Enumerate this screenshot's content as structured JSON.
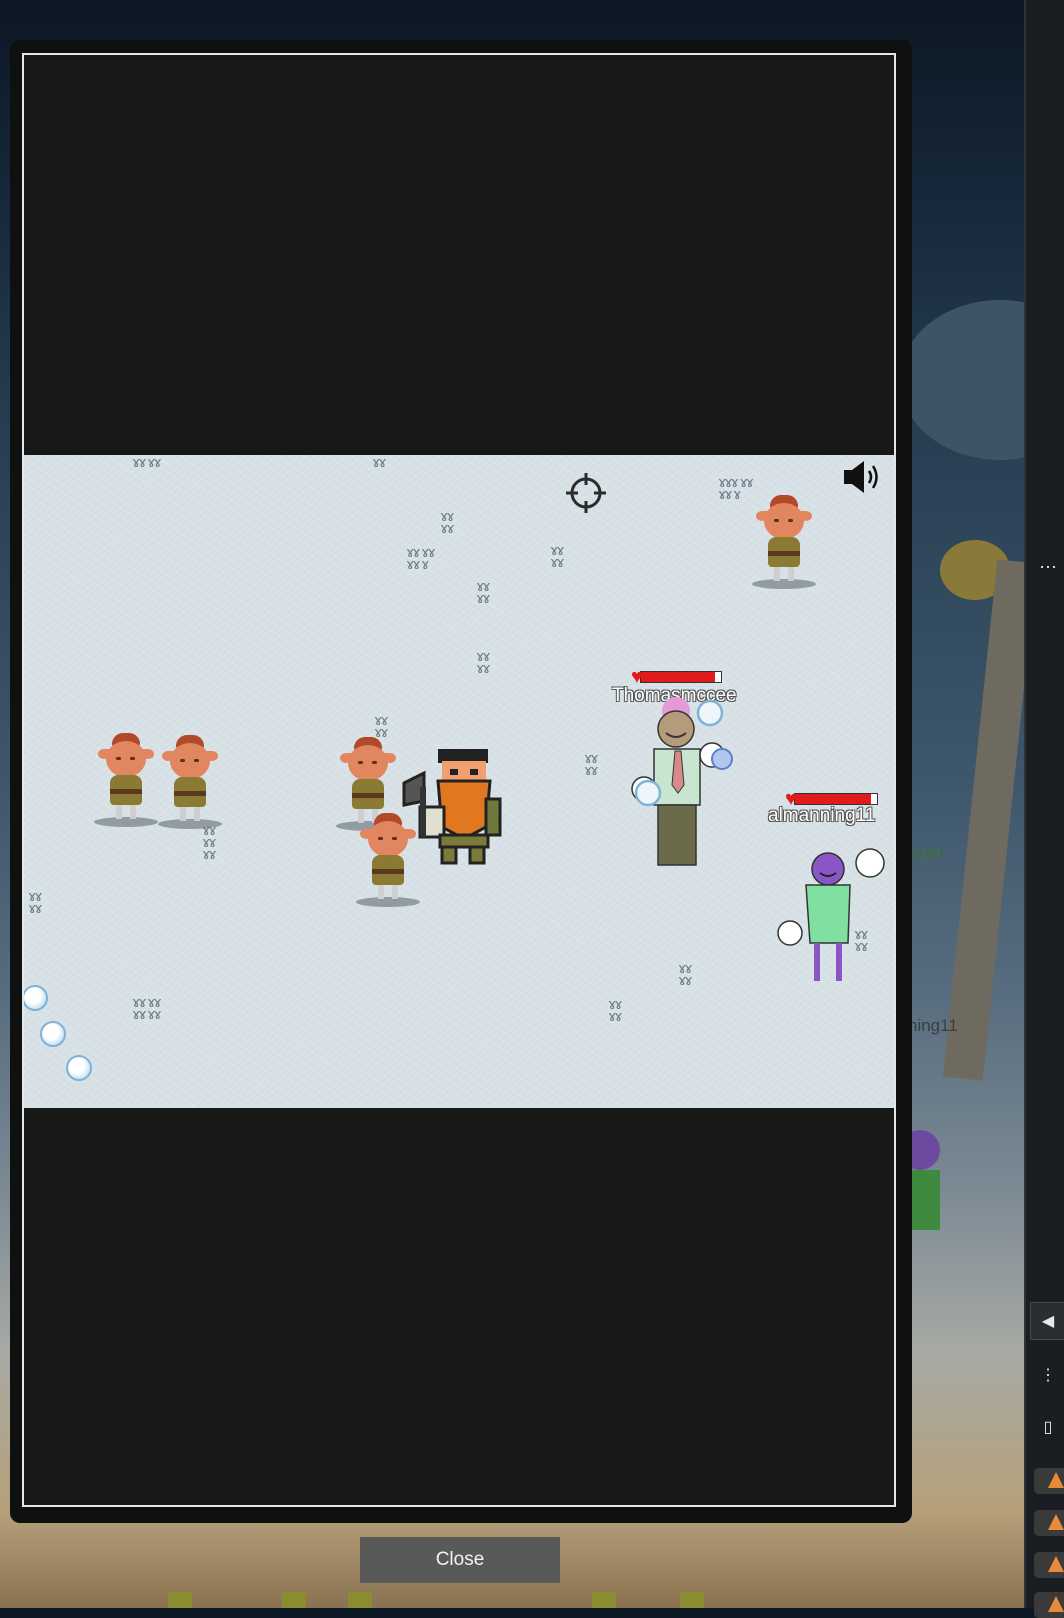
{
  "background": {
    "player_labels": [
      "ugat",
      "ning11"
    ]
  },
  "game": {
    "players": [
      {
        "name": "Thomasmccee",
        "health_fraction": 0.92
      },
      {
        "name": "almanning11",
        "health_fraction": 0.93
      }
    ],
    "sound_icon": "speaker-icon",
    "crosshair_icon": "crosshair-icon"
  },
  "modal": {
    "close_label": "Close"
  },
  "right_panel": {
    "more_icon": "ellipsis-icon",
    "collapse_icon": "chevron-left-icon",
    "menu_icon": "vertical-dots-icon",
    "sidebar_icon": "sidebar-toggle-icon",
    "warning_icon": "warning-icon"
  },
  "colors": {
    "snow": "#d7e1e6",
    "health_red": "#e11b1b",
    "close_button": "#595959",
    "warning": "#e88a3a"
  }
}
